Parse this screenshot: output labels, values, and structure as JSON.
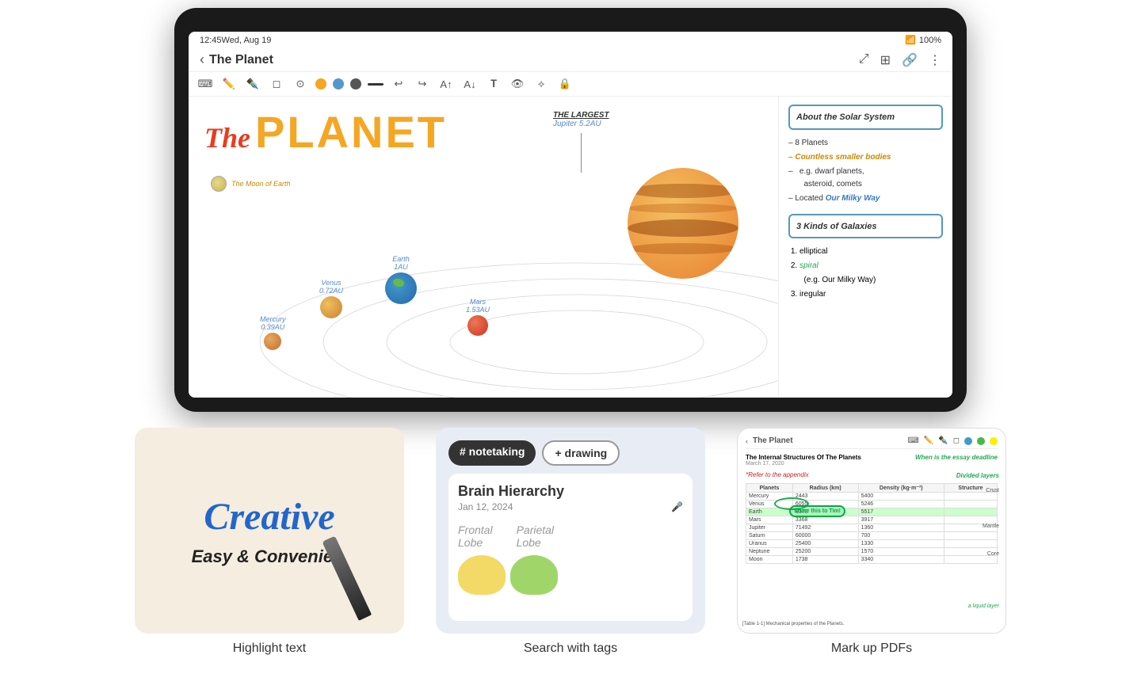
{
  "tablet": {
    "statusBar": {
      "time": "12:45",
      "date": "Wed, Aug 19",
      "battery": "100%",
      "signal": "●●●"
    },
    "navBar": {
      "backLabel": "‹",
      "title": "The Planet",
      "icons": [
        "⊻",
        "⊞",
        "⌗",
        "⋮"
      ]
    },
    "toolbar": {
      "icons": [
        "▤",
        "✏",
        "✒",
        "◇",
        "⊙"
      ],
      "colors": [
        "#f5a623",
        "#5599cc",
        "#555555"
      ],
      "lineColor": "#333333",
      "actionIcons": [
        "↩",
        "↪",
        "A↑",
        "A↓",
        "𝐓",
        "🔒",
        "⟡",
        "⊕"
      ]
    },
    "notes": {
      "title_the": "The",
      "title_planet": "PLANET",
      "jupiter_largest": "THE LARGEST",
      "jupiter_dist": "Jupiter 5.2AU",
      "moon_label": "The Moon of Earth",
      "earth_label": "Earth",
      "earth_dist": "1AU",
      "venus_label": "Venus",
      "venus_dist": "0.72AU",
      "mercury_label": "Mercury",
      "mercury_dist": "0.39AU",
      "mars_label": "Mars",
      "mars_dist": "1.53AU"
    },
    "rightPanel": {
      "box1": "About the Solar System",
      "items": [
        "8 Planets",
        "Countless smaller bodies",
        "e.g. dwarf planets, asteroid, comets",
        "Located Our Milky Way"
      ],
      "box2": "3 Kinds of Galaxies",
      "galaxies": [
        "elliptical",
        "spiral",
        "(e.g. Our Milky Way)",
        "iregular"
      ]
    }
  },
  "features": [
    {
      "id": "highlight-text",
      "label": "Highlight text",
      "creative": "Creative",
      "sub": "Easy & Convenie..."
    },
    {
      "id": "search-tags",
      "label": "Search with tags",
      "tag1": "# notetaking",
      "tag2": "+ drawing",
      "noteTitle": "Brain Hierarchy",
      "noteDate": "Jan 12, 2024",
      "noteLabels": [
        "Frontal",
        "Parietal",
        "Lobe",
        "Lobe"
      ]
    },
    {
      "id": "markup-pdfs",
      "label": "Mark up PDFs",
      "pdfTitle": "The Internal Structures Of The Planets",
      "pdfDate": "March 17, 2020",
      "handwriting1": "*Refer to the appendix",
      "handwriting2": "Divided layers",
      "shareText": "Share this to Tim!",
      "essayNote": "When is the essay deadline",
      "tableHeaders": [
        "Planets",
        "Radius (km)",
        "Density (kg·m⁻³)",
        "Structure of th"
      ],
      "tableRows": [
        [
          "Mercury",
          "2443",
          "5400",
          ""
        ],
        [
          "Venus",
          "6055",
          "5246",
          "Crust"
        ],
        [
          "Earth",
          "6378",
          "5517",
          ""
        ],
        [
          "Mars",
          "3368",
          "3917",
          "Mantle"
        ],
        [
          "Jupiter",
          "71492",
          "1360",
          ""
        ],
        [
          "Saturn",
          "60000",
          "700",
          ""
        ],
        [
          "Uranus",
          "25400",
          "1330",
          "Core"
        ],
        [
          "Neptune",
          "25200",
          "1570",
          ""
        ],
        [
          "Moon",
          "1738",
          "3340",
          "a liquid layer"
        ]
      ]
    }
  ]
}
